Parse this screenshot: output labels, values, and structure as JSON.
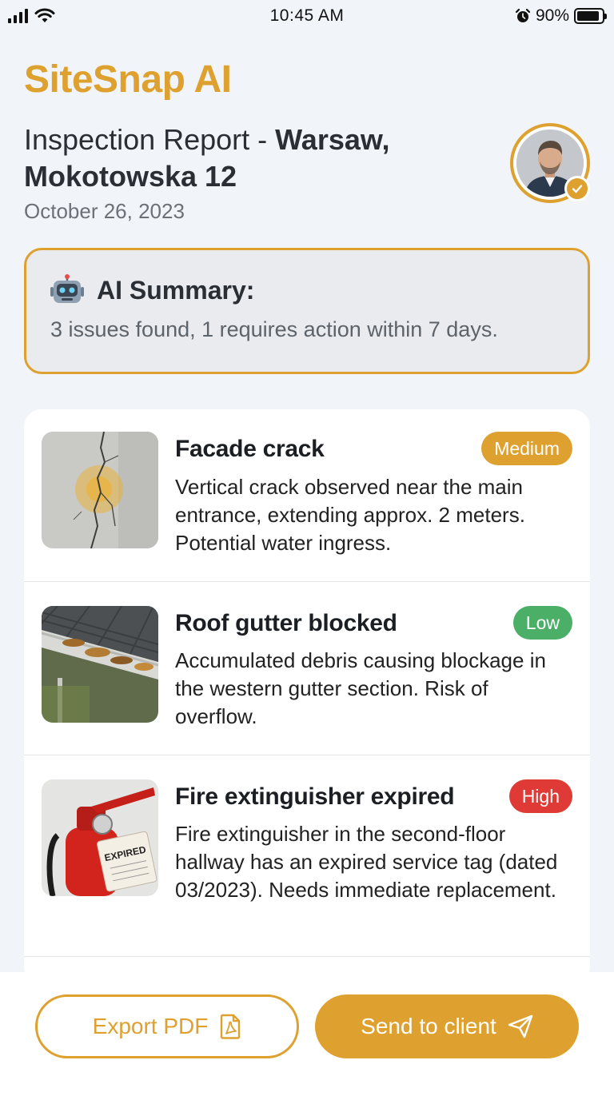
{
  "status_bar": {
    "time": "10:45 AM",
    "battery_text": "90%",
    "battery_level": 0.9,
    "icons": [
      "signal-icon",
      "wifi-icon",
      "alarm-icon",
      "battery-icon"
    ]
  },
  "header": {
    "app_title": "SiteSnap AI",
    "report_prefix": "Inspection Report - ",
    "report_location": "Warsaw, Mokotowska 12",
    "date": "October 26, 2023"
  },
  "summary": {
    "icon": "robot-icon",
    "title": "AI Summary:",
    "text": "3 issues found, 1 requires action within 7 days."
  },
  "issues": [
    {
      "title": "Facade crack",
      "severity": "Medium",
      "severity_color": "#dea12f",
      "description": "Vertical crack observed near the main entrance, extending approx. 2 meters. Potential water ingress.",
      "thumb": "facade-crack-photo"
    },
    {
      "title": "Roof gutter blocked",
      "severity": "Low",
      "severity_color": "#4caf68",
      "description": "Accumulated debris causing blockage in the western gutter section. Risk of overflow.",
      "thumb": "roof-gutter-photo"
    },
    {
      "title": "Fire extinguisher expired",
      "severity": "High",
      "severity_color": "#e03a36",
      "description": "Fire extinguisher in the second-floor hallway has an expired service tag (dated 03/2023). Needs immediate replacement.",
      "thumb": "fire-extinguisher-photo",
      "tag_text": "EXPIRED"
    }
  ],
  "actions": {
    "export_label": "Export PDF",
    "send_label": "Send to client"
  },
  "colors": {
    "accent": "#dea12f",
    "background": "#f1f4f8"
  }
}
